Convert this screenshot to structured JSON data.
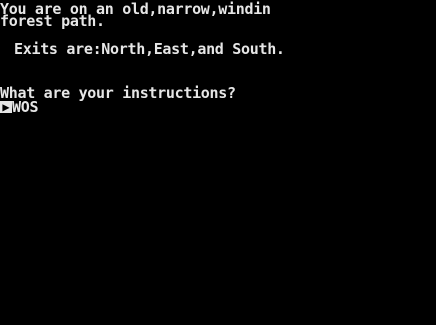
{
  "colors": {
    "background": "#000000",
    "text": "#e6e6e6",
    "frame": "#ffffff"
  },
  "terminal": {
    "description_line1": "You are on an old,narrow,windin",
    "description_line2": "forest path.",
    "exits": "Exits are:North,East,and South.",
    "prompt": "What are your instructions?",
    "cursor_glyph": "▶",
    "input": "WOS"
  }
}
